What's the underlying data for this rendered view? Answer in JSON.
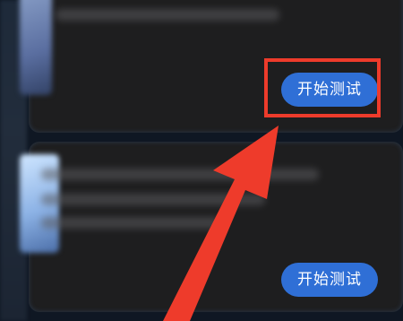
{
  "cards": [
    {
      "button_label": "开始测试",
      "highlighted": true
    },
    {
      "button_label": "开始测试",
      "highlighted": false
    }
  ],
  "colors": {
    "button": "#2f6fd6",
    "annotation": "#ee3b2b",
    "card": "#1e1e1f"
  },
  "annotation": {
    "icon": "arrow-pointing-up-right"
  }
}
